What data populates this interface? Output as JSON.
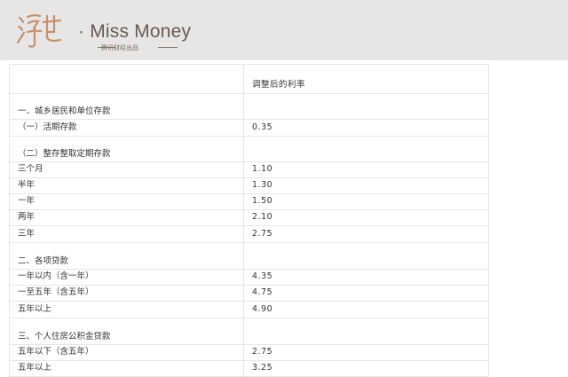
{
  "brand": {
    "logo_text": "浮世",
    "name": "· Miss Money",
    "sub": "腾讯财经出品"
  },
  "table": {
    "header": {
      "col1": "",
      "col2": "调整后的利率"
    },
    "rows": [
      {
        "label": "一、城乡居民和单位存款",
        "value": ""
      },
      {
        "label": "（一）活期存款",
        "value": "0.35"
      },
      {
        "label": "（二）整存整取定期存款",
        "value": ""
      },
      {
        "label": "三个月",
        "value": "1.10"
      },
      {
        "label": "半年",
        "value": "1.30"
      },
      {
        "label": "一年",
        "value": "1.50"
      },
      {
        "label": "两年",
        "value": "2.10"
      },
      {
        "label": "三年",
        "value": "2.75"
      },
      {
        "label": "二、各项贷款",
        "value": ""
      },
      {
        "label": "一年以内（含一年）",
        "value": "4.35"
      },
      {
        "label": "一至五年（含五年）",
        "value": "4.75"
      },
      {
        "label": "五年以上",
        "value": "4.90"
      },
      {
        "label": "三、个人住房公积金贷款",
        "value": ""
      },
      {
        "label": "五年以下（含五年）",
        "value": "2.75"
      },
      {
        "label": "五年以上",
        "value": "3.25"
      }
    ]
  }
}
